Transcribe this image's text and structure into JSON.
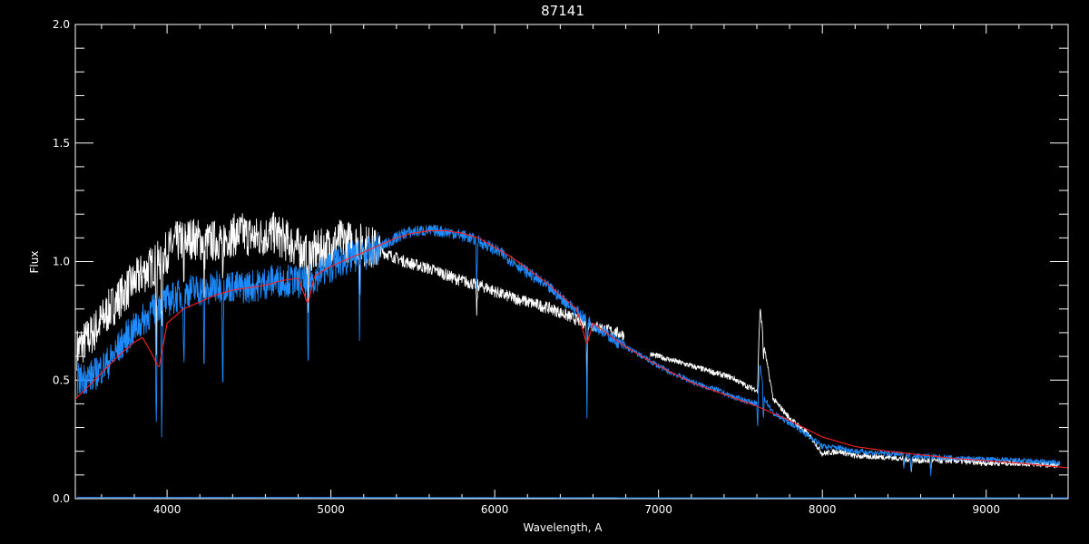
{
  "chart_data": {
    "type": "line",
    "title": "87141",
    "xlabel": "Wavelength, A",
    "ylabel": "Flux",
    "xlim": [
      3440,
      9500
    ],
    "ylim": [
      0.0,
      2.0
    ],
    "x_ticks": [
      "4000",
      "5000",
      "6000",
      "7000",
      "8000",
      "9000"
    ],
    "y_ticks": [
      "0.0",
      "0.5",
      "1.0",
      "1.5",
      "2.0"
    ],
    "x_tick_values": [
      4000,
      5000,
      6000,
      7000,
      8000,
      9000
    ],
    "y_tick_values": [
      0.0,
      0.5,
      1.0,
      1.5,
      2.0
    ],
    "grid": false,
    "background": "#000000",
    "axis_color": "#ffffff",
    "series": [
      {
        "color": "#ffffff",
        "segments": [
          {
            "x": [
              3450,
              3550,
              3650,
              3750,
              3850,
              3950,
              4050,
              4150,
              4250,
              4350,
              4450,
              4550,
              4650,
              4750,
              4850,
              4950,
              5050,
              5150,
              5250,
              5350,
              5450,
              5550,
              5650,
              5750,
              5850,
              5950,
              6050,
              6150,
              6250,
              6350,
              6450,
              6550,
              6650,
              6790
            ],
            "y": [
              0.63,
              0.7,
              0.8,
              0.88,
              0.95,
              1.0,
              1.08,
              1.1,
              1.08,
              1.1,
              1.12,
              1.1,
              1.12,
              1.08,
              1.03,
              1.05,
              1.09,
              1.08,
              1.06,
              1.03,
              1.0,
              0.98,
              0.96,
              0.93,
              0.91,
              0.89,
              0.86,
              0.84,
              0.82,
              0.8,
              0.77,
              0.74,
              0.72,
              0.69
            ]
          },
          {
            "x": [
              6950,
              7050,
              7150,
              7250,
              7350,
              7450,
              7550,
              7600,
              7620,
              7650,
              7700,
              7750,
              7800,
              7850,
              7900,
              7950,
              8000,
              8100,
              8200,
              8400,
              8600,
              8800,
              9000,
              9200,
              9450
            ],
            "y": [
              0.61,
              0.59,
              0.57,
              0.55,
              0.53,
              0.51,
              0.47,
              0.46,
              0.8,
              0.62,
              0.42,
              0.38,
              0.34,
              0.31,
              0.28,
              0.24,
              0.19,
              0.2,
              0.18,
              0.175,
              0.16,
              0.16,
              0.15,
              0.15,
              0.14
            ]
          }
        ]
      },
      {
        "color": "#1e8cff",
        "segments": [
          {
            "x": [
              3450,
              3550,
              3650,
              3750,
              3850,
              3950,
              4050,
              4150,
              4250,
              4350,
              4450,
              4550,
              4650,
              4750,
              4850,
              4950,
              5050,
              5150,
              5250,
              5350,
              5450,
              5550,
              5650,
              5750,
              5850,
              5950,
              6050,
              6150,
              6250,
              6350,
              6450,
              6550,
              6650,
              6750,
              6850,
              6950,
              7050,
              7150,
              7250,
              7350,
              7450,
              7550,
              7600,
              7620,
              7650,
              7700,
              7750,
              7800,
              7850,
              7900,
              7950,
              8000,
              8100,
              8200,
              8400,
              8600,
              8800,
              9000,
              9200,
              9450
            ],
            "y": [
              0.5,
              0.52,
              0.58,
              0.68,
              0.75,
              0.82,
              0.85,
              0.88,
              0.88,
              0.9,
              0.89,
              0.9,
              0.92,
              0.92,
              0.91,
              0.96,
              1.0,
              1.02,
              1.04,
              1.08,
              1.12,
              1.13,
              1.13,
              1.12,
              1.1,
              1.07,
              1.03,
              0.98,
              0.93,
              0.88,
              0.82,
              0.76,
              0.71,
              0.66,
              0.62,
              0.58,
              0.54,
              0.51,
              0.48,
              0.46,
              0.43,
              0.41,
              0.4,
              0.56,
              0.42,
              0.36,
              0.34,
              0.32,
              0.3,
              0.27,
              0.25,
              0.22,
              0.215,
              0.2,
              0.19,
              0.18,
              0.17,
              0.165,
              0.16,
              0.15
            ]
          }
        ]
      },
      {
        "color": "#ff2020",
        "segments": [
          {
            "x": [
              3440,
              3500,
              3600,
              3700,
              3800,
              3850,
              3900,
              3950,
              4000,
              4100,
              4200,
              4300,
              4400,
              4500,
              4600,
              4700,
              4800,
              4860,
              4900,
              5000,
              5100,
              5200,
              5300,
              5400,
              5500,
              5600,
              5700,
              5800,
              5900,
              6000,
              6100,
              6200,
              6300,
              6400,
              6500,
              6563,
              6600,
              6700,
              6800,
              6900,
              7000,
              7200,
              7400,
              7600,
              7800,
              8000,
              8200,
              8400,
              8600,
              8800,
              9000,
              9200,
              9500
            ],
            "y": [
              0.42,
              0.46,
              0.53,
              0.6,
              0.66,
              0.68,
              0.62,
              0.55,
              0.74,
              0.8,
              0.83,
              0.86,
              0.88,
              0.89,
              0.9,
              0.92,
              0.93,
              0.82,
              0.94,
              0.98,
              1.01,
              1.04,
              1.07,
              1.1,
              1.12,
              1.13,
              1.13,
              1.12,
              1.1,
              1.06,
              1.02,
              0.97,
              0.92,
              0.86,
              0.8,
              0.65,
              0.74,
              0.69,
              0.64,
              0.6,
              0.56,
              0.49,
              0.44,
              0.39,
              0.33,
              0.26,
              0.22,
              0.2,
              0.185,
              0.17,
              0.16,
              0.15,
              0.13
            ]
          }
        ]
      },
      {
        "color": "#1e8cff",
        "segments": [
          {
            "x": [
              3450,
              5000,
              6000,
              7000,
              8000,
              8100,
              9500
            ],
            "y": [
              0.005,
              0.005,
              0.004,
              0.003,
              0.003,
              0.003,
              0.003
            ]
          }
        ]
      }
    ],
    "absorption_lines": {
      "x": [
        3934,
        3968,
        4102,
        4226,
        4340,
        4861,
        5175,
        5890,
        6563,
        7605,
        7640,
        8498,
        8542,
        8662
      ],
      "depth": [
        0.55,
        0.6,
        0.35,
        0.35,
        0.45,
        0.45,
        0.3,
        0.2,
        0.4,
        0.15,
        0.15,
        0.06,
        0.08,
        0.08
      ]
    }
  }
}
